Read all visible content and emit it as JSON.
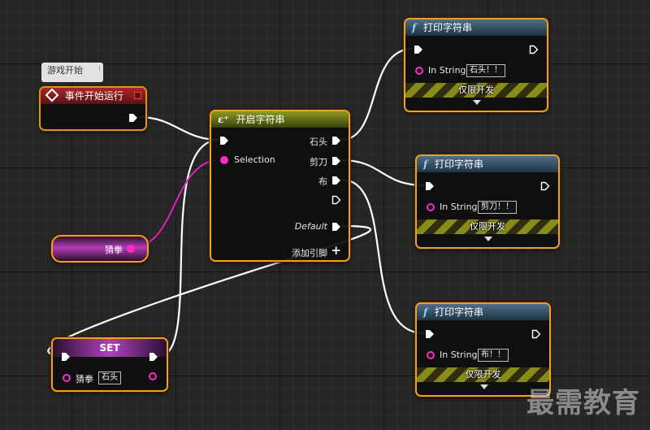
{
  "comment_bubble": {
    "text": "游戏开始"
  },
  "begin_play": {
    "title": "事件开始运行"
  },
  "switch_node": {
    "title": "开启字符串",
    "selection_label": "Selection",
    "outputs": [
      "石头",
      "剪刀",
      "布"
    ],
    "default_label": "Default",
    "add_pin_label": "添加引脚"
  },
  "variable_getter": {
    "label": "猜拳"
  },
  "set_node": {
    "title": "SET",
    "var_label": "猜拳",
    "var_value": "石头"
  },
  "print_nodes": [
    {
      "title": "打印字符串",
      "in_string_label": "In String",
      "value": "石头！！",
      "dev_only": "仅限开发"
    },
    {
      "title": "打印字符串",
      "in_string_label": "In String",
      "value": "剪刀！！",
      "dev_only": "仅限开发"
    },
    {
      "title": "打印字符串",
      "in_string_label": "In String",
      "value": "布！！",
      "dev_only": "仅限开发"
    }
  ],
  "watermark": "最需教育",
  "colors": {
    "node_border": "#f0a020",
    "string_pin": "#ff28c8",
    "exec_wire": "#ffffff"
  }
}
